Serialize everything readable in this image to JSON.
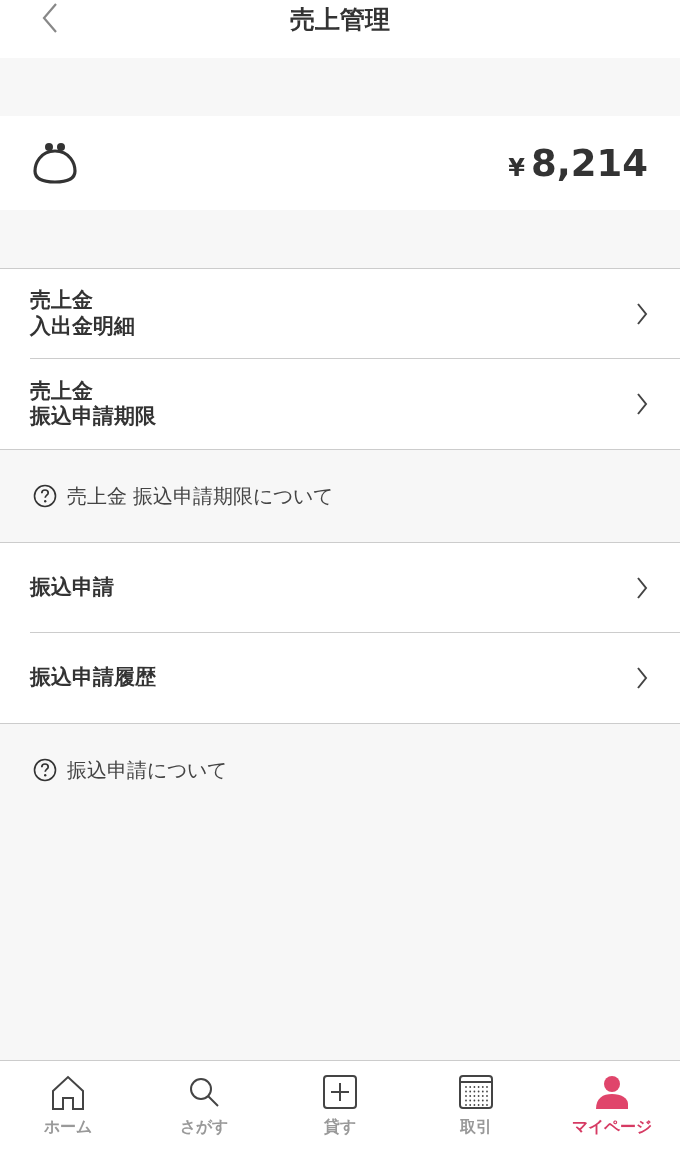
{
  "header": {
    "title": "売上管理"
  },
  "balance": {
    "currency": "¥",
    "amount": "8,214"
  },
  "sections": [
    {
      "rows": [
        {
          "lines": [
            "売上金",
            "入出金明細"
          ]
        },
        {
          "lines": [
            "売上金",
            "振込申請期限"
          ]
        }
      ],
      "note": "売上金 振込申請期限について"
    },
    {
      "rows": [
        {
          "lines": [
            "振込申請"
          ]
        },
        {
          "lines": [
            "振込申請履歴"
          ]
        }
      ],
      "note": "振込申請について"
    }
  ],
  "tab_bar": [
    {
      "kind": "home",
      "label": "ホーム",
      "selected": false
    },
    {
      "kind": "search",
      "label": "さがす",
      "selected": false
    },
    {
      "kind": "add",
      "label": "貸す",
      "selected": false
    },
    {
      "kind": "calendar",
      "label": "取引",
      "selected": false
    },
    {
      "kind": "person",
      "label": "マイページ",
      "selected": true
    }
  ]
}
